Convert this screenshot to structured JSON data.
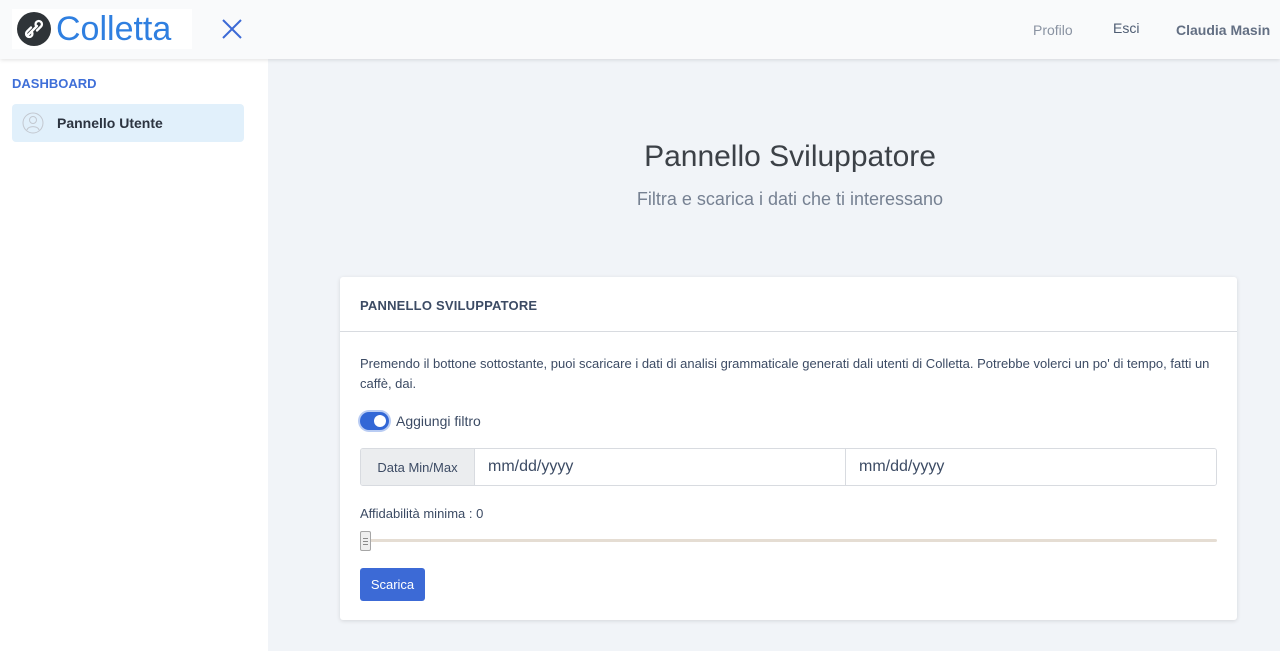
{
  "header": {
    "logo_text": "Colletta",
    "nav": {
      "profilo": "Profilo",
      "esci": "Esci",
      "user": "Claudia Masin"
    }
  },
  "sidebar": {
    "title": "DASHBOARD",
    "items": [
      {
        "label": "Pannello Utente",
        "icon": "user-icon",
        "active": true
      }
    ]
  },
  "main": {
    "title": "Pannello Sviluppatore",
    "subtitle": "Filtra e scarica i dati che ti interessano"
  },
  "card": {
    "header": "PANNELLO SVILUPPATORE",
    "description": "Premendo il bottone sottostante, puoi scaricare i dati di analisi grammaticale generati dali utenti di Colletta. Potrebbe volerci un po' di tempo, fatti un caffè, dai.",
    "filter_toggle": {
      "label": "Aggiungi filtro",
      "checked": true
    },
    "date_range": {
      "prepend": "Data Min/Max",
      "min_placeholder": "mm/dd/yyyy",
      "max_placeholder": "mm/dd/yyyy"
    },
    "slider": {
      "label": "Affidabilità minima : 0",
      "value": 0
    },
    "download_button": "Scarica"
  },
  "colors": {
    "accent": "#3c6ad6",
    "logo": "#2f7fe0",
    "sidebar_active_bg": "#e1f0fb"
  }
}
